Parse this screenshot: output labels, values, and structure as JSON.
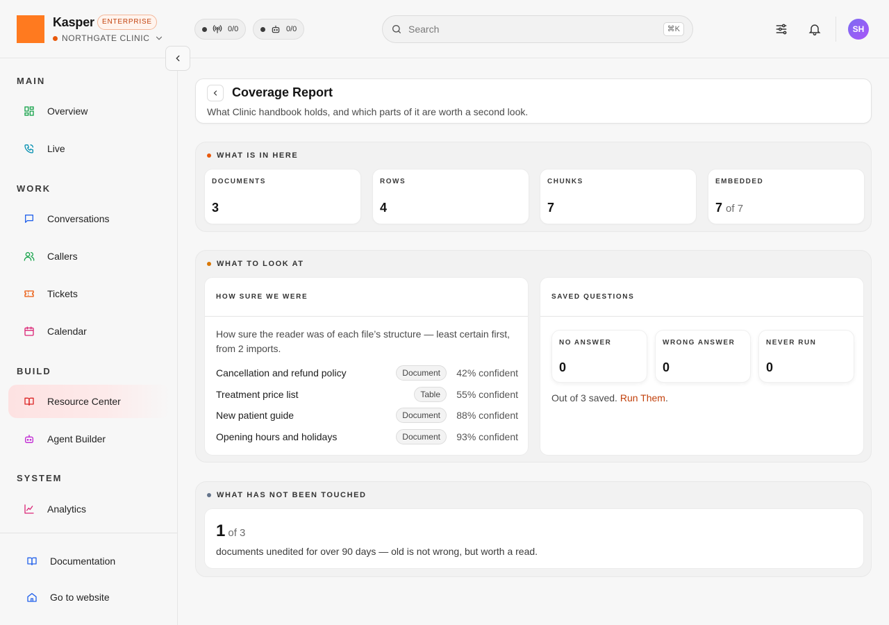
{
  "header": {
    "brand": "Kasper",
    "plan_badge": "ENTERPRISE",
    "org_name": "NORTHGATE CLINIC",
    "pills": [
      {
        "icon": "broadcast-icon",
        "value": "0/0"
      },
      {
        "icon": "robot-icon",
        "value": "0/0"
      }
    ],
    "search": {
      "placeholder": "Search",
      "shortcut": "⌘K"
    },
    "avatar_initials": "SH"
  },
  "sidebar": {
    "sections": [
      {
        "title": "MAIN",
        "items": [
          {
            "label": "Overview",
            "icon": "grid-icon"
          },
          {
            "label": "Live",
            "icon": "phone-icon"
          }
        ]
      },
      {
        "title": "WORK",
        "items": [
          {
            "label": "Conversations",
            "icon": "chat-icon"
          },
          {
            "label": "Callers",
            "icon": "users-icon"
          },
          {
            "label": "Tickets",
            "icon": "ticket-icon"
          },
          {
            "label": "Calendar",
            "icon": "calendar-icon"
          }
        ]
      },
      {
        "title": "BUILD",
        "items": [
          {
            "label": "Resource Center",
            "icon": "book-icon",
            "active": true
          },
          {
            "label": "Agent Builder",
            "icon": "robot-icon"
          }
        ]
      },
      {
        "title": "SYSTEM",
        "items": [
          {
            "label": "Analytics",
            "icon": "chart-line-icon"
          }
        ]
      }
    ],
    "footer": [
      {
        "label": "Documentation",
        "icon": "book-open-icon"
      },
      {
        "label": "Go to website",
        "icon": "home-icon"
      }
    ]
  },
  "page": {
    "title": "Coverage Report",
    "subtitle": "What Clinic handbook holds, and which parts of it are worth a second look."
  },
  "what_is_in_here": {
    "title": "WHAT IS IN HERE",
    "stats": [
      {
        "label": "DOCUMENTS",
        "value": "3",
        "of": ""
      },
      {
        "label": "ROWS",
        "value": "4",
        "of": ""
      },
      {
        "label": "CHUNKS",
        "value": "7",
        "of": ""
      },
      {
        "label": "EMBEDDED",
        "value": "7",
        "of": "of 7"
      }
    ]
  },
  "what_to_look_at": {
    "title": "WHAT TO LOOK AT",
    "confidence": {
      "title": "HOW SURE WE WERE",
      "description": "How sure the reader was of each file’s structure — least certain first, from 2 imports.",
      "rows": [
        {
          "name": "Cancellation and refund policy",
          "type": "Document",
          "confidence": "42% confident"
        },
        {
          "name": "Treatment price list",
          "type": "Table",
          "confidence": "55% confident"
        },
        {
          "name": "New patient guide",
          "type": "Document",
          "confidence": "88% confident"
        },
        {
          "name": "Opening hours and holidays",
          "type": "Document",
          "confidence": "93% confident"
        }
      ]
    },
    "saved_questions": {
      "title": "SAVED QUESTIONS",
      "boxes": [
        {
          "label": "NO ANSWER",
          "value": "0"
        },
        {
          "label": "WRONG ANSWER",
          "value": "0"
        },
        {
          "label": "NEVER RUN",
          "value": "0"
        }
      ],
      "summary": "Out of 3 saved.",
      "link": "Run Them",
      "link_suffix": "."
    }
  },
  "untouched": {
    "title": "WHAT HAS NOT BEEN TOUCHED",
    "count": "1",
    "of": "of 3",
    "note": "documents unedited for over 90 days — old is not wrong, but worth a read."
  },
  "colors": {
    "brand": "#ff7a1f",
    "accent_link": "#c2410c",
    "active_nav_bg": "#fde2e2",
    "dot_orange": "#e8590c",
    "dot_amber": "#d97706",
    "dot_slate": "#64748b"
  }
}
